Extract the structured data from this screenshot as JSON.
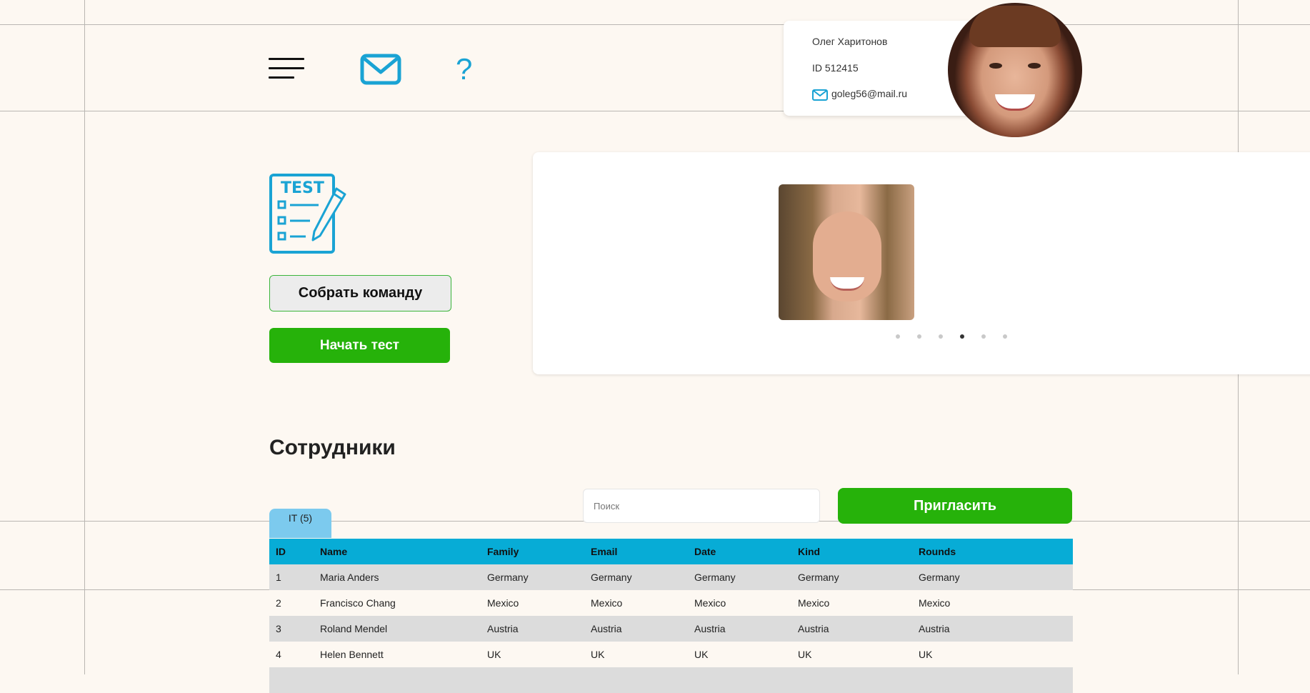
{
  "nav": {
    "menu_icon": "hamburger-menu-icon",
    "mail_icon": "envelope-icon",
    "help_label": "?"
  },
  "profile": {
    "name": "Олег Харитонов",
    "id": "ID 512415",
    "email": "goleg56@mail.ru"
  },
  "actions": {
    "team_button": "Собрать команду",
    "start_test_button": "Начать тест"
  },
  "slider": {
    "dot_count": 6,
    "active_dot": 4
  },
  "staff": {
    "title": "Сотрудники",
    "search_placeholder": "Поиск",
    "invite_button": "Пригласить",
    "group_tab": "IT (5)",
    "columns": [
      "ID",
      "Name",
      "Family",
      "Email",
      "Date",
      "Kind",
      "Rounds"
    ],
    "rows": [
      [
        "1",
        "Maria Anders",
        "Germany",
        "Germany",
        "Germany",
        "Germany",
        "Germany"
      ],
      [
        "2",
        "Francisco Chang",
        "Mexico",
        "Mexico",
        "Mexico",
        "Mexico",
        "Mexico"
      ],
      [
        "3",
        "Roland Mendel",
        "Austria",
        "Austria",
        "Austria",
        "Austria",
        "Austria"
      ],
      [
        "4",
        "Helen Bennett",
        "UK",
        "UK",
        "UK",
        "UK",
        "UK"
      ],
      [
        "",
        "",
        "",
        "",
        "",
        "",
        ""
      ]
    ]
  },
  "colors": {
    "background": "#fdf8f2",
    "accent_blue": "#07acd6",
    "icon_blue": "#1aa3d4",
    "primary_green": "#26b20a",
    "tab_blue": "#7ccaee"
  }
}
